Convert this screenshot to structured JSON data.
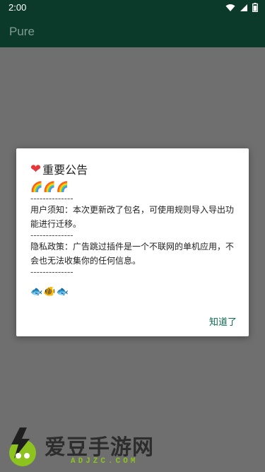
{
  "status_bar": {
    "time": "2:00",
    "icons": [
      "wifi-icon",
      "signal-icon",
      "battery-icon"
    ]
  },
  "app_bar": {
    "title": "Pure"
  },
  "dialog": {
    "title_icon": "heart-icon",
    "title": "重要公告",
    "emoji_top": "🌈🌈🌈",
    "divider": "--------------",
    "notice_1": "用户须知：本次更新改了包名，可使用规则导入导出功能进行迁移。",
    "notice_2": "隐私政策：广告跳过插件是一个不联网的单机应用，不会也无法收集你的任何信息。",
    "emoji_bottom": "🐟🐠🐟",
    "action_label": "知道了"
  },
  "watermark": {
    "brand": "爱豆手游网",
    "domain": "ADJZC.COM"
  },
  "colors": {
    "app_bar": "#0b3a2b",
    "scrim": "#6f6f6f",
    "accent": "#0e6a4e"
  }
}
